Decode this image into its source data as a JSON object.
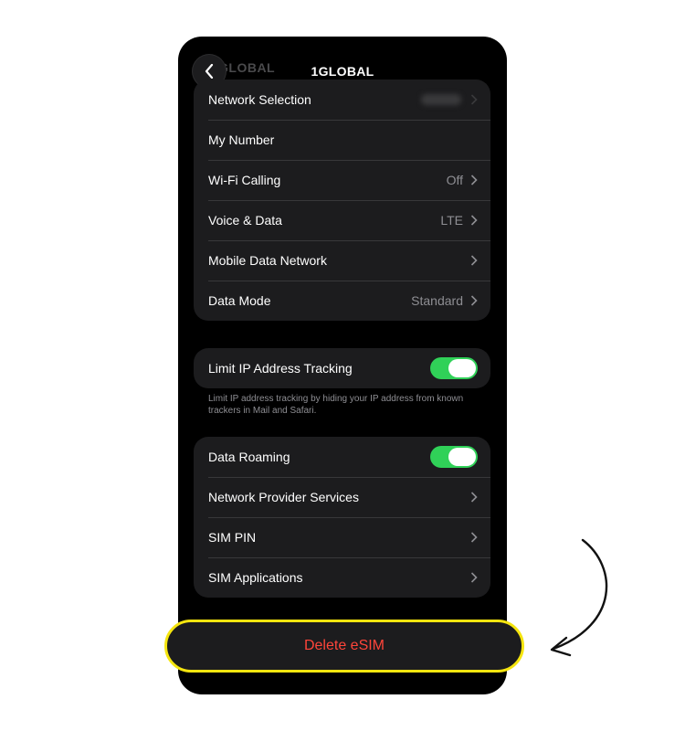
{
  "header": {
    "title": "1GLOBAL",
    "ghost_title": "GLOBAL"
  },
  "network_group": [
    {
      "label": "Network Selection",
      "value": "",
      "blurred": true
    },
    {
      "label": "My Number",
      "value": ""
    },
    {
      "label": "Wi-Fi Calling",
      "value": "Off"
    },
    {
      "label": "Voice & Data",
      "value": "LTE"
    },
    {
      "label": "Mobile Data Network",
      "value": ""
    },
    {
      "label": "Data Mode",
      "value": "Standard"
    }
  ],
  "ip_tracking": {
    "label": "Limit IP Address Tracking",
    "enabled": true,
    "footnote": "Limit IP address tracking by hiding your IP address from known trackers in Mail and Safari."
  },
  "roaming_group": [
    {
      "label": "Data Roaming",
      "toggle": true,
      "enabled": true
    },
    {
      "label": "Network Provider Services"
    },
    {
      "label": "SIM PIN"
    },
    {
      "label": "SIM Applications"
    }
  ],
  "delete_button": {
    "label": "Delete eSIM"
  },
  "colors": {
    "accent_green": "#30d158",
    "destructive_red": "#ff453a",
    "highlight_yellow": "#f5e50f"
  },
  "icons": [
    "back-chevron-icon",
    "chevron-right-icon",
    "curved-arrow-icon"
  ]
}
